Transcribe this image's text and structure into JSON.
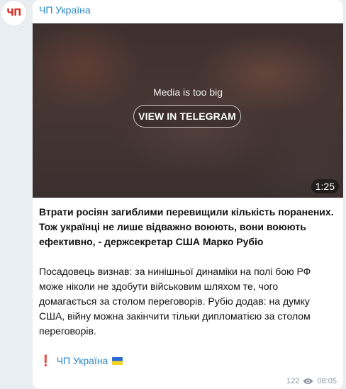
{
  "channel": {
    "avatar_text": "ЧП",
    "name": "ЧП Україна"
  },
  "media": {
    "message": "Media is too big",
    "view_button": "VIEW IN TELEGRAM",
    "duration": "1:25"
  },
  "post": {
    "headline": "Втрати росіян загиблими перевищили кількість поранених. Тож українці не лише відважно воюють, вони воюють ефективно, - держсекретар США Марко Рубіо",
    "body": "Посадовець визнав: за нинішньої динаміки на полі бою РФ може ніколи не здобути військовим шляхом те, чого домагається за столом переговорів. Рубіо додав: на думку США, війну можна закінчити тільки дипломатією за столом переговорів.",
    "signature_label": "ЧП Україна",
    "signature_icon": "exclamation-icon",
    "flag_icon": "ukraine-flag-icon"
  },
  "meta": {
    "views": "122",
    "time": "08:05",
    "views_icon": "eye-icon"
  },
  "colors": {
    "link": "#2b87c7",
    "background": "#e9eef3",
    "avatar_accent": "#e0251b"
  }
}
